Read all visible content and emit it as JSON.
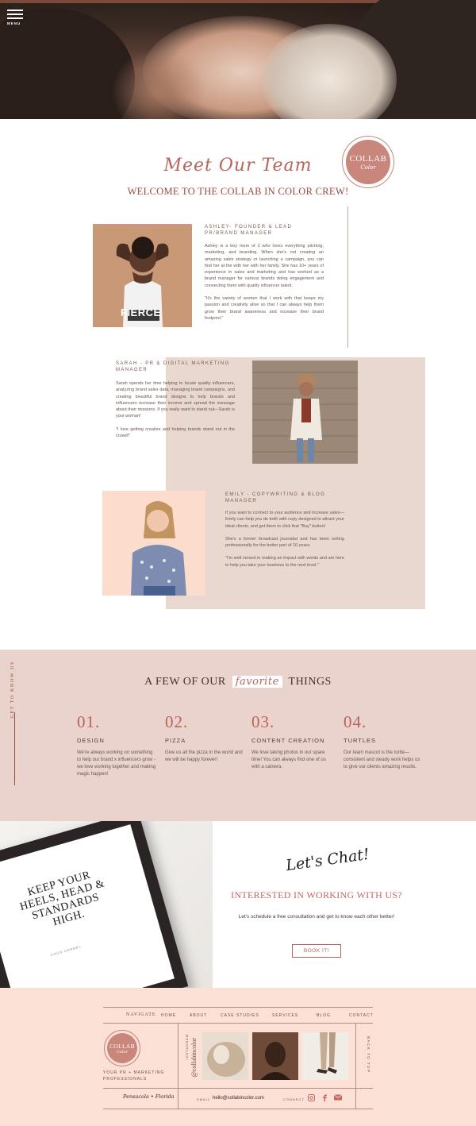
{
  "header": {
    "menu_label": "MENU"
  },
  "team_section": {
    "script_title": "Meet Our Team",
    "welcome": "WELCOME TO THE COLLAB IN COLOR CREW!",
    "badge": {
      "line1": "COLLAB",
      "line2": "Color"
    },
    "members": [
      {
        "title": "ASHLEY- FOUNDER & LEAD PR/BRAND MANAGER",
        "paragraphs": [
          "Ashley is a boy mom of 2 who loves everything pitching, marketing, and branding. When she's not creating an amazing sales strategy or launching a campaign, you can find her at the with her with her family. She has 10+ years of experience in sales and marketing and has worked as a brand manager for various brands doing engagement and connecting them with quality influencer talent.",
          "\"It's the variety of women that I work with that keeps my passion and creativity alive so that I can always help them grow their brand awareness and increase their brand footprint.\""
        ],
        "shirt_text": "FIERCE"
      },
      {
        "title": "SARAH - PR & DIGITAL MARKETING MANAGER",
        "paragraphs": [
          "Sarah spends her time helping to locate quality influencers, analyzing brand sales data, managing brand campaigns, and creating beautiful brand designs to help brands and influencers increase their income and spread the message about their missions. If you really want to stand out—Sarah is your woman!",
          "\"I love getting creative and helping brands stand out in the crowd!\""
        ]
      },
      {
        "title": "EMILY - COPYWRITING & BLOG MANAGER",
        "paragraphs": [
          "If you want to connect to your audience and increase sales—Emily can help you do both with copy designed to attract your ideal clients, and get them to click that \"Buy\" button!",
          "She's a former broadcast journalist and has been writing professionally for the better part of 10 years.",
          "\"I'm well versed in making an impact with words and am here to help you take your business to the next level.\""
        ]
      }
    ]
  },
  "favorites": {
    "side_label": "GET TO KNOW US",
    "heading_before": "A FEW OF OUR",
    "heading_script": "favorite",
    "heading_after": "THINGS",
    "items": [
      {
        "num": "01.",
        "title": "DESIGN",
        "text": "We're always working on something to help our brand x influencers grow - we love working together and making magic happen!"
      },
      {
        "num": "02.",
        "title": "PIZZA",
        "text": "Give us all the pizza in the world and we will be happy forever!"
      },
      {
        "num": "03.",
        "title": "CONTENT CREATION",
        "text": "We love taking photos in our spare time! You can always find one of us with a camera."
      },
      {
        "num": "04.",
        "title": "TURTLES",
        "text": "Our team mascot is the turtle—consistent and steady work helps us to give our clients amazing results."
      }
    ]
  },
  "chat": {
    "poster_quote": "KEEP YOUR HEELS, HEAD & STANDARDS HIGH.",
    "poster_credit": "COCO CHANEL",
    "script": "Let's Chat!",
    "heading": "INTERESTED IN WORKING WITH US?",
    "text": "Let's schedule a free consultation and get to know each other better!",
    "button": "BOOK IT!"
  },
  "footer": {
    "navigate_label": "NAVIGATE",
    "nav": [
      "HOME",
      "ABOUT",
      "CASE STUDIES",
      "SERVICES",
      "BLOG",
      "CONTACT"
    ],
    "badge": {
      "line1": "COLLAB",
      "line2": "Color"
    },
    "tagline": "YOUR PR + MARKETING PROFESSIONALS",
    "instagram_label": "INSTAGRAM",
    "instagram_handle": "@collabincolor",
    "back_to_top": "BACK TO TOP",
    "location": "Pensacola • Florida",
    "email_label": "EMAIL",
    "email": "hello@collabincolor.com",
    "connect_label": "CONNECT",
    "social_icons": [
      "instagram-icon",
      "facebook-icon",
      "mail-icon"
    ]
  },
  "colors": {
    "accent": "#b8645a",
    "heading": "#9b4a3d",
    "panel_beige": "#e9d8cf",
    "section_pink": "#ead3cd",
    "footer_bg": "#fbe0d6"
  }
}
